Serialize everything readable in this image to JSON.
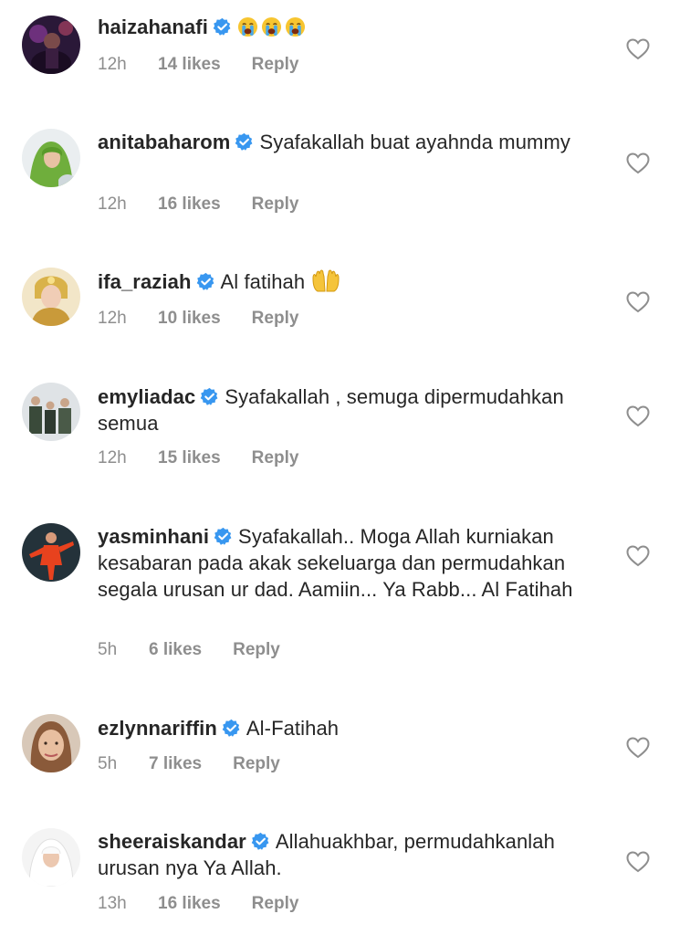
{
  "colors": {
    "text": "#262626",
    "muted": "#8e8e8e",
    "verified": "#3897f0"
  },
  "comments": [
    {
      "username": "haizahanafi",
      "text": "",
      "emoji": [
        "loudly-crying-face",
        "loudly-crying-face",
        "loudly-crying-face"
      ],
      "time": "12h",
      "likes": "14 likes",
      "reply": "Reply"
    },
    {
      "username": "anitabaharom",
      "text": "Syafakallah buat ayahnda mummy",
      "time": "12h",
      "likes": "16 likes",
      "reply": "Reply"
    },
    {
      "username": "ifa_raziah",
      "text": "Al fatihah",
      "emoji": [
        "palms-up-together"
      ],
      "time": "12h",
      "likes": "10 likes",
      "reply": "Reply"
    },
    {
      "username": "emyliadac",
      "text": "Syafakallah , semuga dipermudahkan semua",
      "time": "12h",
      "likes": "15 likes",
      "reply": "Reply"
    },
    {
      "username": "yasminhani",
      "text": "Syafakallah.. Moga Allah kurniakan kesabaran pada akak sekeluarga dan permudahkan segala urusan ur dad. Aamiin... Ya Rabb... Al Fatihah",
      "time": "5h",
      "likes": "6 likes",
      "reply": "Reply"
    },
    {
      "username": "ezlynnariffin",
      "text": "Al-Fatihah",
      "time": "5h",
      "likes": "7 likes",
      "reply": "Reply"
    },
    {
      "username": "sheeraiskandar",
      "text": "Allahuakhbar, permudahkanlah urusan nya Ya Allah.",
      "time": "13h",
      "likes": "16 likes",
      "reply": "Reply"
    }
  ]
}
